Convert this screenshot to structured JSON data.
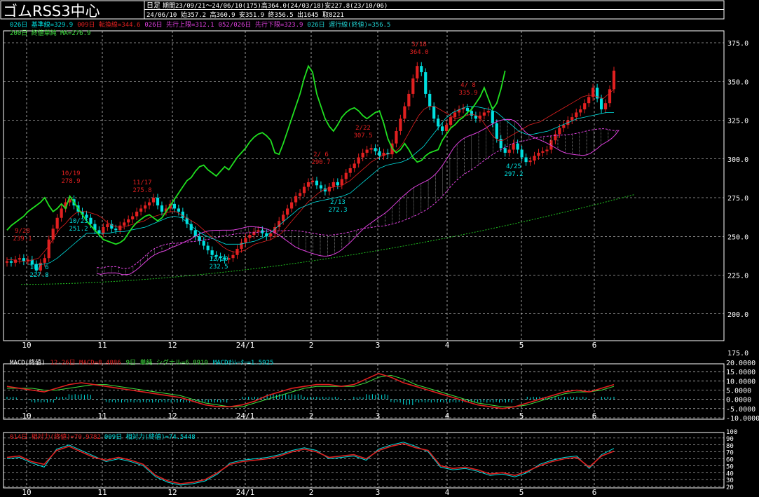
{
  "header": {
    "title": "ゴムRSS3中心",
    "period_type": "日足",
    "period_info": "期間23/09/21～24/06/10(175)高364.0(24/03/18)安227.8(23/10/06)",
    "date": "24/06/10",
    "ohlc_info": "始357.2 高360.9 安351.9 終356.5 出1645 取8221"
  },
  "legend_main": [
    {
      "text": "026日 基準線=329.9",
      "color": "#00e0e0"
    },
    {
      "text": "009日 転換線=344.6",
      "color": "#e02020"
    },
    {
      "text": "026日 先行上限=312.1",
      "color": "#e040e0"
    },
    {
      "text": "052/026日 先行下限=323.9",
      "color": "#e040e0"
    },
    {
      "text": "026日 遅行線(終値)=356.5",
      "color": "#20d0d0"
    }
  ],
  "legend_main2": [
    {
      "text": "200日 終値単純 MA=276.9",
      "color": "#40e040"
    }
  ],
  "legend_macd": [
    {
      "text": "MACD(終値)",
      "color": "#ffffff"
    },
    {
      "text": "12-26日 MACD=8.4886",
      "color": "#e02020"
    },
    {
      "text": "9日 単純 シグナル=6.8910",
      "color": "#40e040"
    },
    {
      "text": "MACDｵｼﾚｰﾀｰ=1.5925",
      "color": "#00e0e0"
    }
  ],
  "legend_rsi": [
    {
      "text": "014日 相対力(終値)=70.9782",
      "color": "#e02020"
    },
    {
      "text": "009日 相対力(終値)=74.5448",
      "color": "#00e0e0"
    }
  ],
  "x_labels": [
    "10",
    "11",
    "12",
    "24/1",
    "2",
    "3",
    "4",
    "5",
    "6"
  ],
  "annotations": [
    {
      "date": "10/19",
      "value": "278.9",
      "color": "#e02020"
    },
    {
      "date": "11/17",
      "value": "275.8",
      "color": "#e02020"
    },
    {
      "date": "9/28",
      "value": "239.1",
      "color": "#e02020"
    },
    {
      "date": "10/23",
      "value": "251.2",
      "color": "#00e0e0"
    },
    {
      "date": "10/ 6",
      "value": "227.8",
      "color": "#00e0e0"
    },
    {
      "date": "12/20",
      "value": "232.5",
      "color": "#00e0e0"
    },
    {
      "date": "2/ 6",
      "value": "290.7",
      "color": "#e02020"
    },
    {
      "date": "2/13",
      "value": "272.3",
      "color": "#00e0e0"
    },
    {
      "date": "2/22",
      "value": "307.5",
      "color": "#e02020"
    },
    {
      "date": "3/18",
      "value": "364.0",
      "color": "#e02020"
    },
    {
      "date": "4/ 8",
      "value": "335.9",
      "color": "#e02020"
    },
    {
      "date": "4/25",
      "value": "297.2",
      "color": "#00e0e0"
    }
  ],
  "colors": {
    "background": "#000000",
    "grid": "#ffffff",
    "candle_up": "#e02020",
    "candle_down": "#00e0e0",
    "tenkan": "#e02020",
    "kijun": "#00e0e0",
    "span_a": "#e040e0",
    "span_b": "#e040e0",
    "chikou": "#20e020",
    "ma200": "#20c020",
    "macd": "#e02020",
    "signal": "#40e040",
    "osc": "#00e0e0",
    "rsi14": "#e02020",
    "rsi9": "#00e0e0"
  },
  "chart_data": [
    {
      "type": "candlestick",
      "panel": "price",
      "ylim": [
        175,
        375
      ],
      "yticks": [
        "175.0",
        "200.0",
        "225.0",
        "250.0",
        "275.0",
        "300.0",
        "325.0",
        "350.0",
        "375.0"
      ],
      "y_values": [
        175,
        200,
        225,
        250,
        275,
        300,
        325,
        350,
        375
      ],
      "grid": true,
      "close": [
        234,
        233,
        235,
        236,
        234,
        235,
        232,
        228,
        233,
        236,
        248,
        255,
        262,
        268,
        272,
        274,
        270,
        266,
        264,
        262,
        258,
        254,
        252,
        256,
        258,
        255,
        254,
        257,
        259,
        261,
        263,
        266,
        268,
        270,
        272,
        275,
        270,
        266,
        268,
        271,
        268,
        266,
        262,
        258,
        254,
        250,
        247,
        244,
        241,
        238,
        237,
        236,
        235,
        236,
        238,
        242,
        246,
        249,
        251,
        253,
        254,
        252,
        250,
        252,
        256,
        260,
        264,
        268,
        272,
        276,
        278,
        282,
        285,
        286,
        283,
        281,
        279,
        282,
        285,
        283,
        287,
        291,
        294,
        297,
        301,
        304,
        306,
        307,
        305,
        302,
        304,
        303,
        310,
        318,
        326,
        334,
        342,
        352,
        360,
        356,
        342,
        334,
        326,
        321,
        318,
        322,
        327,
        330,
        332,
        333,
        331,
        328,
        326,
        328,
        330,
        331,
        323,
        313,
        307,
        304,
        306,
        310,
        306,
        301,
        298,
        299,
        302,
        304,
        305,
        306,
        312,
        316,
        320,
        322,
        325,
        327,
        330,
        332,
        336,
        340,
        346,
        339,
        332,
        336,
        345,
        357
      ],
      "tenkan": [
        235,
        235,
        234,
        234,
        234,
        235,
        236,
        240,
        244,
        250,
        255,
        258,
        262,
        265,
        266,
        266,
        265,
        264,
        262,
        259,
        257,
        256,
        256,
        257,
        258,
        259,
        260,
        262,
        263,
        264,
        265,
        266,
        266,
        264,
        262,
        260,
        258,
        255,
        252,
        249,
        246,
        243,
        241,
        240,
        240,
        241,
        243,
        245,
        246,
        247,
        248,
        250,
        252,
        256,
        260,
        264,
        268,
        272,
        275,
        278,
        280,
        281,
        282,
        282,
        284,
        286,
        289,
        292,
        295,
        298,
        300,
        302,
        303,
        304,
        306,
        310,
        316,
        322,
        328,
        332,
        334,
        334,
        332,
        330,
        328,
        326,
        327,
        328,
        329,
        328,
        325,
        320,
        315,
        312,
        312,
        314,
        316,
        318,
        320,
        322,
        323,
        324,
        326,
        328,
        330,
        332,
        334,
        336,
        338,
        340,
        341,
        341,
        340,
        339,
        342,
        345
      ],
      "kijun": [
        232,
        232,
        232,
        233,
        236,
        240,
        244,
        248,
        252,
        252,
        252,
        252,
        253,
        253,
        254,
        255,
        256,
        258,
        260,
        262,
        263,
        262,
        258,
        254,
        251,
        249,
        247,
        245,
        245,
        245,
        246,
        247,
        249,
        252,
        256,
        260,
        264,
        268,
        270,
        272,
        273,
        274,
        275,
        276,
        278,
        282,
        286,
        290,
        294,
        296,
        297,
        298,
        300,
        304,
        308,
        314,
        320,
        326,
        330,
        332,
        334,
        334,
        333,
        332,
        330,
        326,
        322,
        318,
        316,
        316,
        317,
        318,
        320,
        322,
        324,
        326,
        327,
        328,
        329,
        330,
        330
      ]
    },
    {
      "type": "line",
      "panel": "macd",
      "ylim": [
        -10,
        20
      ],
      "yticks": [
        "20.0000",
        "15.0000",
        "10.0000",
        "5.0000",
        "0.0000",
        "-5.0000",
        "-10.0000"
      ],
      "y_values": [
        20,
        15,
        10,
        5,
        0,
        -5,
        -10
      ],
      "series": [
        {
          "name": "12-26日 MACD",
          "values": [
            7,
            6,
            5,
            4,
            6,
            8,
            9,
            8,
            7,
            6,
            5,
            4,
            3,
            2,
            1,
            -1,
            -3,
            -4,
            -4,
            -3,
            -1,
            2,
            4,
            6,
            7,
            8,
            8,
            7,
            8,
            11,
            14,
            12,
            9,
            7,
            5,
            3,
            1,
            -1,
            -3,
            -4,
            -5,
            -4,
            -2,
            0,
            2,
            4,
            5,
            4,
            6,
            8
          ]
        },
        {
          "name": "9日 単純 シグナル",
          "values": [
            6,
            6,
            6,
            5,
            5,
            6,
            7,
            8,
            8,
            7,
            6,
            5,
            4,
            3,
            2,
            0,
            -2,
            -3,
            -4,
            -4,
            -2,
            0,
            2,
            4,
            6,
            7,
            7,
            7,
            7,
            9,
            12,
            13,
            11,
            8,
            6,
            4,
            2,
            0,
            -2,
            -3,
            -4,
            -4,
            -3,
            -1,
            1,
            3,
            4,
            4,
            5,
            7
          ]
        }
      ]
    },
    {
      "type": "line",
      "panel": "rsi",
      "ylim": [
        20,
        100
      ],
      "yticks": [
        "100",
        "90",
        "80",
        "70",
        "60",
        "50",
        "40",
        "30",
        "20"
      ],
      "y_values": [
        100,
        90,
        80,
        70,
        60,
        50,
        40,
        30,
        20
      ],
      "series": [
        {
          "name": "014日 相対力(終値)",
          "values": [
            62,
            64,
            56,
            52,
            72,
            78,
            70,
            62,
            58,
            62,
            58,
            52,
            36,
            28,
            24,
            26,
            30,
            40,
            52,
            56,
            58,
            60,
            64,
            70,
            74,
            70,
            62,
            64,
            66,
            60,
            72,
            78,
            82,
            76,
            72,
            50,
            46,
            48,
            44,
            38,
            40,
            36,
            42,
            50,
            56,
            60,
            62,
            48,
            64,
            71
          ]
        },
        {
          "name": "009日 相対力(終値)",
          "values": [
            60,
            62,
            54,
            48,
            74,
            80,
            72,
            64,
            56,
            60,
            56,
            50,
            34,
            26,
            22,
            24,
            28,
            38,
            54,
            58,
            60,
            62,
            66,
            72,
            76,
            72,
            60,
            62,
            64,
            58,
            74,
            80,
            84,
            78,
            70,
            48,
            44,
            46,
            42,
            36,
            38,
            34,
            40,
            52,
            58,
            62,
            64,
            46,
            66,
            75
          ]
        }
      ]
    }
  ]
}
